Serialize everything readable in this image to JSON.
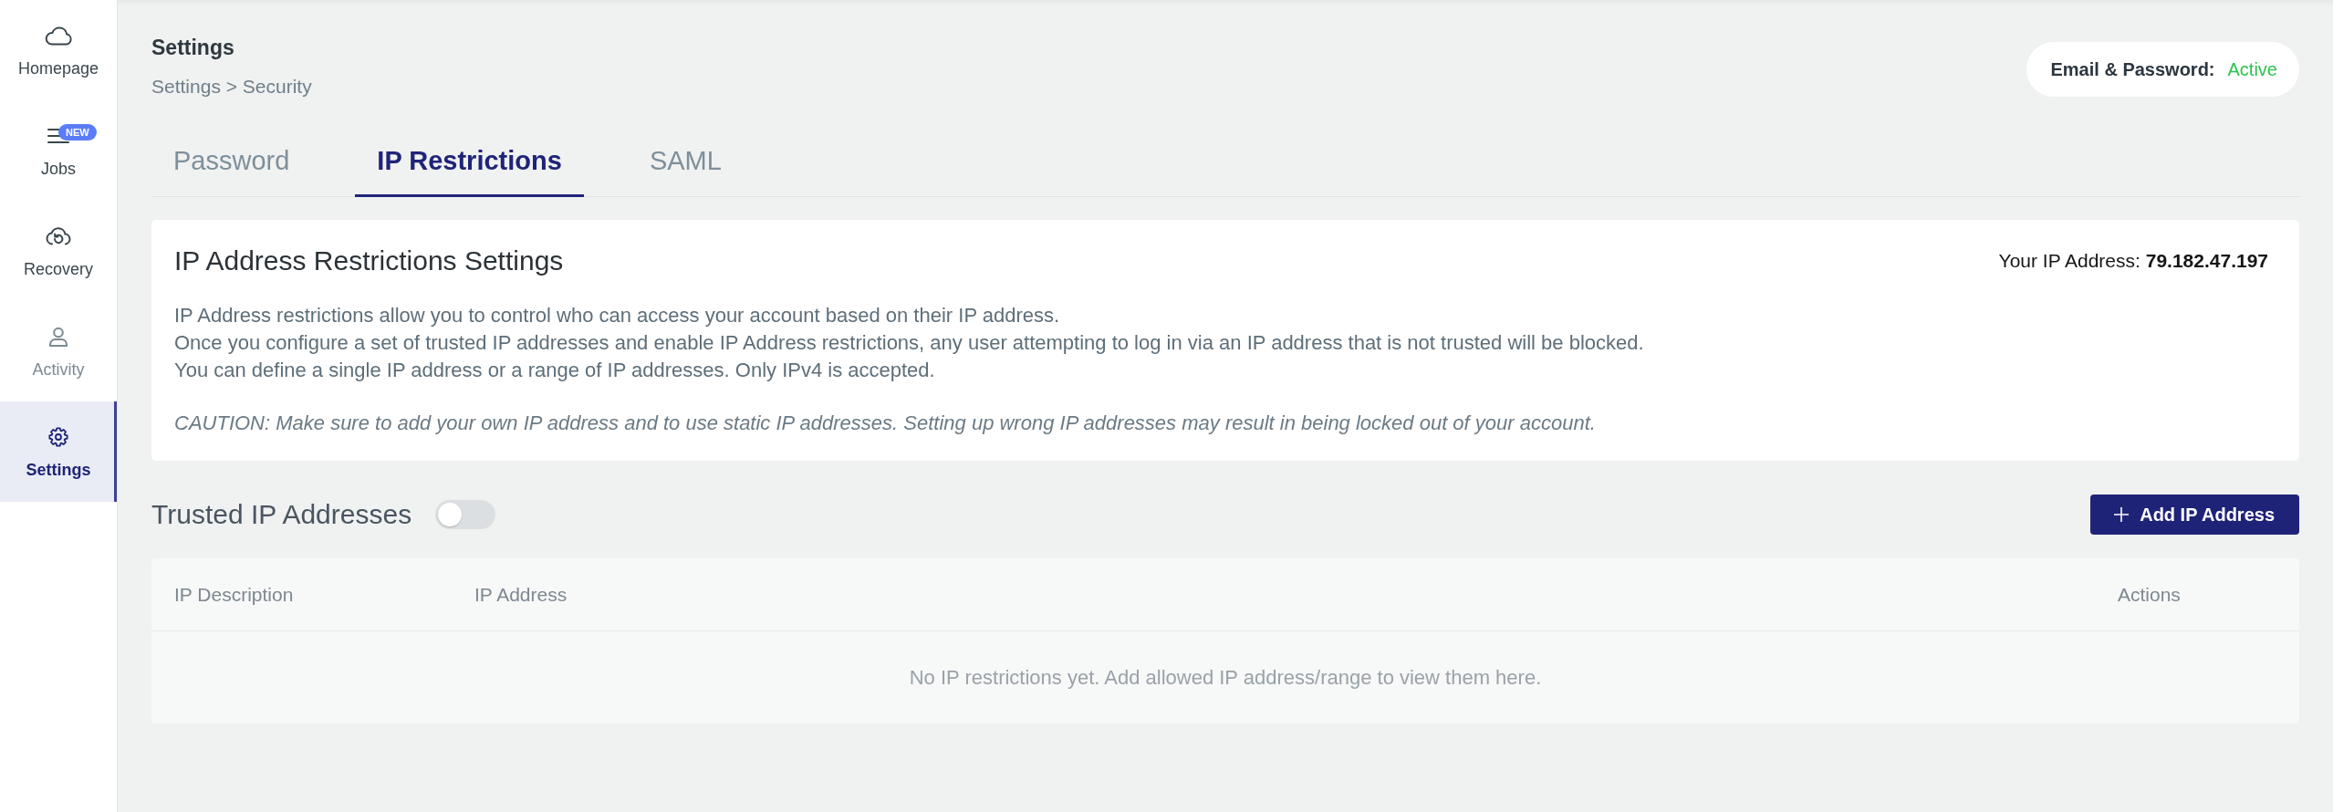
{
  "sidebar": {
    "items": [
      {
        "label": "Homepage",
        "selected": false,
        "disabled": false
      },
      {
        "label": "Jobs",
        "selected": false,
        "disabled": false,
        "badge": "NEW"
      },
      {
        "label": "Recovery",
        "selected": false,
        "disabled": false
      },
      {
        "label": "Activity",
        "selected": false,
        "disabled": true
      },
      {
        "label": "Settings",
        "selected": true,
        "disabled": false
      }
    ]
  },
  "header": {
    "title": "Settings",
    "breadcrumb": "Settings > Security"
  },
  "status_pill": {
    "label": "Email & Password:",
    "value": "Active",
    "active": true
  },
  "tabs": [
    {
      "label": "Password",
      "selected": false
    },
    {
      "label": "IP Restrictions",
      "selected": true
    },
    {
      "label": "SAML",
      "selected": false
    }
  ],
  "info_card": {
    "title": "IP Address Restrictions Settings",
    "ip_address": "Your IP Address: **79.182.47.197**",
    "description": [
      "IP Address restrictions allow you to control who can access your account based on their IP address.",
      "Once you configure a set of trusted IP addresses and enable IP Address restrictions, any user attempting to log in via an IP address that is not trusted will be blocked.",
      "You can define a single IP address or a range of IP addresses. Only IPv4 is accepted."
    ],
    "caution": "CAUTION: Make sure to add your own IP address and to use static IP addresses. Setting up wrong IP addresses may result in being locked out of your account."
  },
  "trusted": {
    "title": "Trusted IP Addresses",
    "enabled": false,
    "add_button": "Add IP Address"
  },
  "table": {
    "columns": [
      "IP Description",
      "IP Address",
      "Actions"
    ],
    "empty_message": "No IP restrictions yet. Add allowed IP address/range to view them here."
  }
}
